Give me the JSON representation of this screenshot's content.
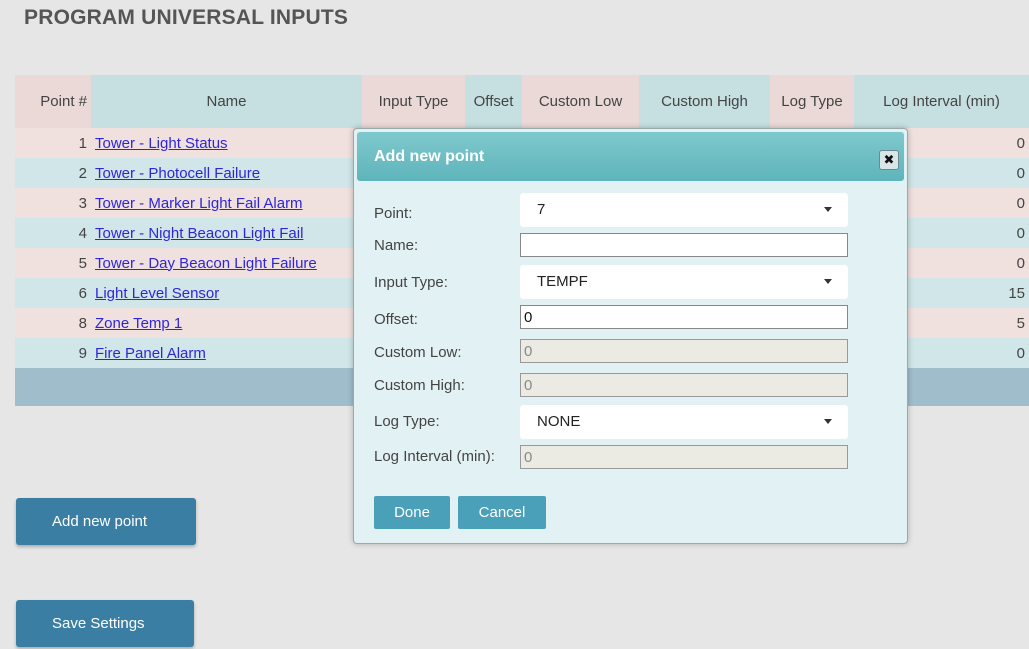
{
  "page": {
    "title": "PROGRAM UNIVERSAL INPUTS"
  },
  "table": {
    "headers": {
      "point": "Point #",
      "name": "Name",
      "input_type": "Input Type",
      "offset": "Offset",
      "custom_low": "Custom Low",
      "custom_high": "Custom High",
      "log_type": "Log Type",
      "log_interval": "Log Interval (min)"
    },
    "rows": [
      {
        "point": "1",
        "name": "Tower - Light Status",
        "log_interval": "0"
      },
      {
        "point": "2",
        "name": "Tower - Photocell Failure",
        "log_interval": "0"
      },
      {
        "point": "3",
        "name": "Tower - Marker Light Fail Alarm",
        "log_interval": "0"
      },
      {
        "point": "4",
        "name": "Tower - Night Beacon Light Fail",
        "log_interval": "0"
      },
      {
        "point": "5",
        "name": "Tower - Day Beacon Light Failure",
        "log_interval": "0"
      },
      {
        "point": "6",
        "name": "Light Level Sensor",
        "log_interval": "15"
      },
      {
        "point": "8",
        "name": "Zone Temp 1",
        "log_interval": "5"
      },
      {
        "point": "9",
        "name": "Fire Panel Alarm",
        "log_interval": "0"
      }
    ]
  },
  "buttons": {
    "add_new_point": "Add new point",
    "save_settings": "Save Settings"
  },
  "dialog": {
    "title": "Add new point",
    "close_icon": "close-icon",
    "fields": {
      "point_label": "Point:",
      "point_value": "7",
      "name_label": "Name:",
      "name_value": "",
      "input_type_label": "Input Type:",
      "input_type_value": "TEMPF",
      "offset_label": "Offset:",
      "offset_value": "0",
      "custom_low_label": "Custom Low:",
      "custom_low_value": "0",
      "custom_high_label": "Custom High:",
      "custom_high_value": "0",
      "log_type_label": "Log Type:",
      "log_type_value": "NONE",
      "log_interval_label": "Log Interval (min):",
      "log_interval_value": "0"
    },
    "done": "Done",
    "cancel": "Cancel"
  },
  "colors": {
    "accent_button": "#3a7fa3",
    "dialog_header": "#5eb4bb",
    "link": "#2f26d8"
  }
}
